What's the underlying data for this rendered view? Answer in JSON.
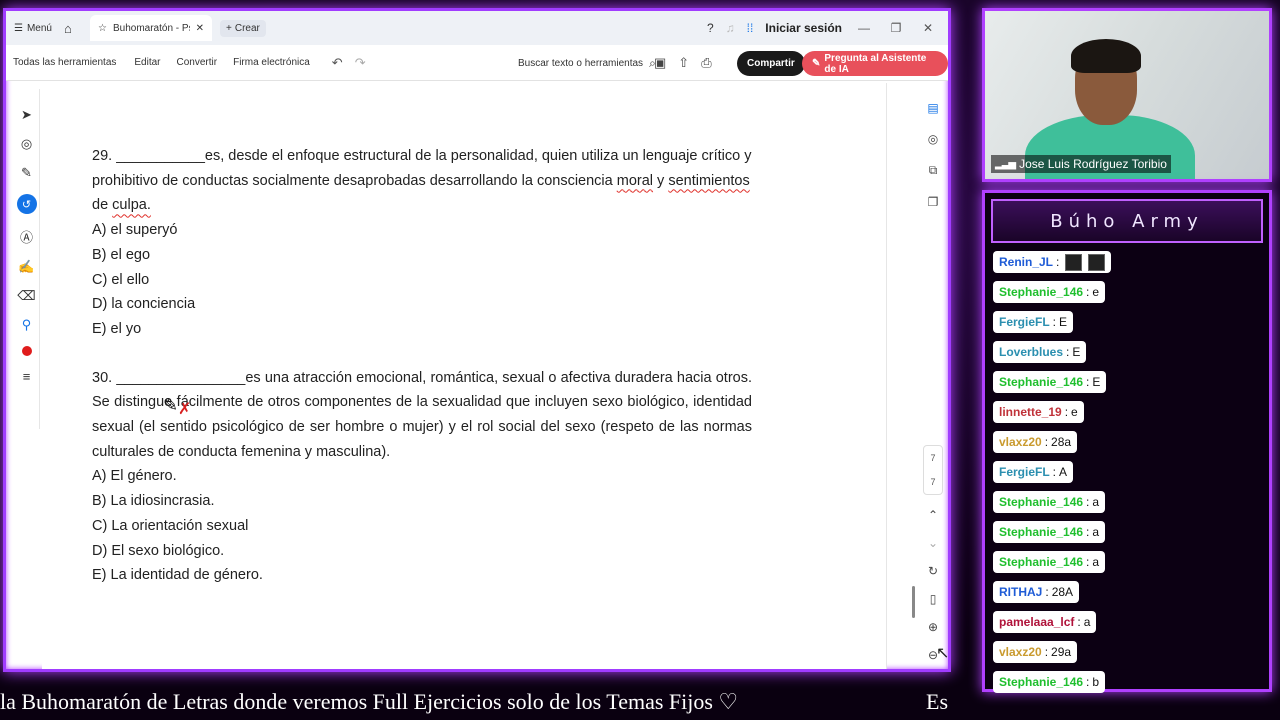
{
  "window": {
    "menu_label": "Menú",
    "tab_title": "Buhomaratón - Psicol...",
    "new_tab_label": "Crear",
    "signin_label": "Iniciar sesión"
  },
  "toolbar": {
    "items": [
      "Todas las herramientas",
      "Editar",
      "Convertir",
      "Firma electrónica"
    ],
    "search_label": "Buscar texto o herramientas",
    "share_label": "Compartir",
    "ai_label": "Pregunta al Asistente de IA"
  },
  "page_numbers": [
    "7",
    "7"
  ],
  "document": {
    "q29": {
      "number": "29.",
      "blank": "___________",
      "text_before": "es, desde el enfoque estructural de la personalidad, quien utiliza un lenguaje crítico y prohibitivo de conductas socialmente desaprobadas desarrollando la consciencia",
      "moral": "moral",
      "y": "y",
      "sentimientos": "sentimientos",
      "de": "de",
      "culpa": "culpa.",
      "options": [
        "A) el superyó",
        "B) el ego",
        "C) el ello",
        "D) la conciencia",
        "E) el yo"
      ]
    },
    "q30": {
      "number": "30.",
      "blank": "________________",
      "text": "es una atracción emocional, romántica, sexual o afectiva duradera hacia otros. Se distingue fácilmente de otros componentes de la sexualidad que incluyen sexo biológico, identidad sexual (el sentido psicológico de ser hombre o mujer) y el rol social del sexo (respeto de las normas culturales de conducta femenina y masculina).",
      "options": [
        "A) El género.",
        "B) La idiosincrasia.",
        "C) La orientación sexual",
        "D) El sexo biológico.",
        "E) La identidad de género."
      ]
    }
  },
  "webcam": {
    "name": "Jose Luis Rodríguez Toribio"
  },
  "chat": {
    "title": "Búho Army",
    "messages": [
      {
        "user": "Renin_JL",
        "text": "",
        "color": "#1e5bd6",
        "emotes": 2
      },
      {
        "user": "Stephanie_146",
        "text": "e",
        "color": "#1fbf2e"
      },
      {
        "user": "FergieFL",
        "text": "E",
        "color": "#2b8fb0"
      },
      {
        "user": "Loverblues",
        "text": "E",
        "color": "#2b8fb0"
      },
      {
        "user": "Stephanie_146",
        "text": "E",
        "color": "#1fbf2e"
      },
      {
        "user": "linnette_19",
        "text": "e",
        "color": "#c0323a"
      },
      {
        "user": "vlaxz20",
        "text": "28a",
        "color": "#c99a2e"
      },
      {
        "user": "FergieFL",
        "text": "A",
        "color": "#2b8fb0"
      },
      {
        "user": "Stephanie_146",
        "text": "a",
        "color": "#1fbf2e"
      },
      {
        "user": "Stephanie_146",
        "text": "a",
        "color": "#1fbf2e"
      },
      {
        "user": "Stephanie_146",
        "text": "a",
        "color": "#1fbf2e"
      },
      {
        "user": "RITHAJ",
        "text": "28A",
        "color": "#1e5bd6"
      },
      {
        "user": "pamelaaa_lcf",
        "text": "a",
        "color": "#b0123a"
      },
      {
        "user": "vlaxz20",
        "text": "29a",
        "color": "#c99a2e"
      },
      {
        "user": "Stephanie_146",
        "text": "b",
        "color": "#1fbf2e"
      }
    ]
  },
  "ticker": {
    "text": "la Buhomaratón de Letras donde veremos Full Ejercicios solo de los Temas Fijos ♡",
    "next": "Es"
  }
}
